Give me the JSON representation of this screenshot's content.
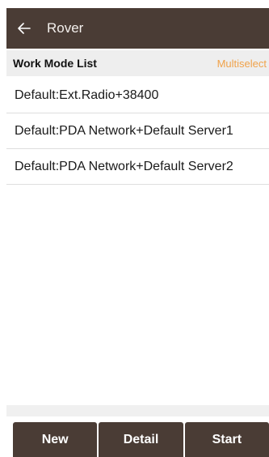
{
  "topbar": {
    "back_icon": "arrow-left-icon",
    "title": "Rover",
    "background": "#4a3c35"
  },
  "list_header": {
    "title": "Work Mode List",
    "action": "Multiselect",
    "action_color": "#f0a24a"
  },
  "work_modes": [
    {
      "label": "Default:Ext.Radio+38400"
    },
    {
      "label": "Default:PDA Network+Default Server1"
    },
    {
      "label": "Default:PDA Network+Default Server2"
    }
  ],
  "bottom_buttons": {
    "new_label": "New",
    "detail_label": "Detail",
    "start_label": "Start"
  }
}
